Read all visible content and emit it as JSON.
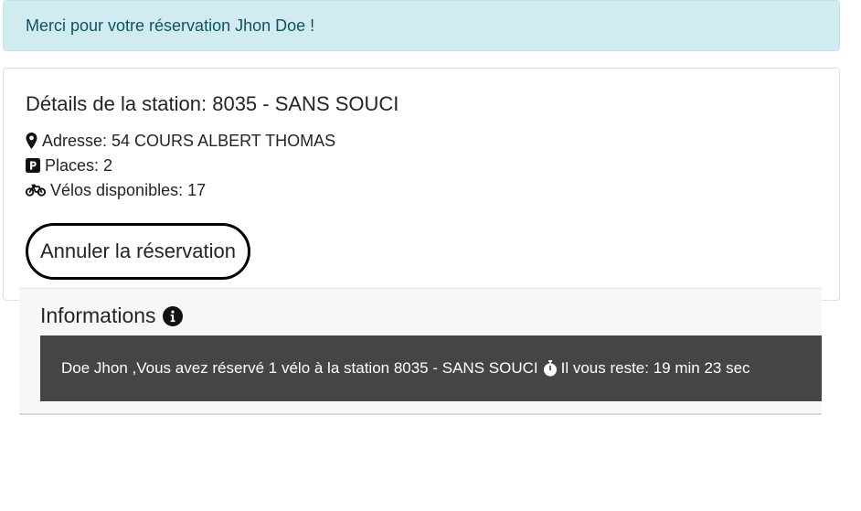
{
  "alert": {
    "message": "Merci pour votre réservation Jhon Doe !"
  },
  "station": {
    "title": "Détails de la station: 8035 - SANS SOUCI",
    "address": "Adresse: 54 COURS ALBERT THOMAS",
    "places": "Places: 2",
    "bikes": "Vélos disponibles: 17",
    "cancel_label": "Annuler la réservation",
    "icons": [
      "map-marker-icon",
      "parking-icon",
      "bicycle-icon"
    ]
  },
  "info": {
    "heading": "Informations",
    "heading_icon": "info-circle-icon",
    "reservation_text": "Doe Jhon ,Vous avez réservé 1 vélo à la station 8035 - SANS SOUCI",
    "timer_icon": "stopwatch-icon",
    "countdown_text": "Il vous reste: 19 min 23 sec"
  },
  "colors": {
    "alert_bg": "#d1ecf1",
    "alert_text": "#0c5460",
    "message_bg": "#454545",
    "panel_bg": "#f7f7f7"
  }
}
